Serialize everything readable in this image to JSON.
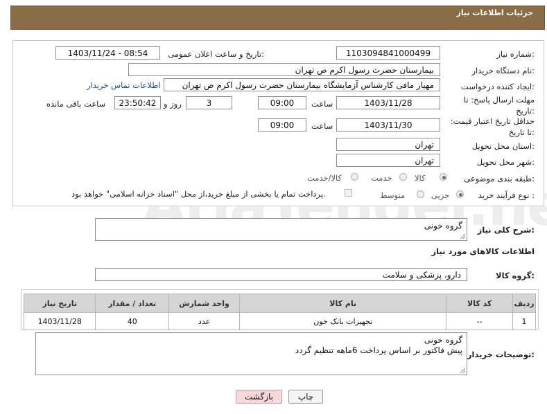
{
  "header": {
    "title": "جزئیات اطلاعات نیاز"
  },
  "form": {
    "need_number_label": "شماره نیاز:",
    "need_number": "1103094841000499",
    "announce_label": "تاریخ و ساعت اعلان عمومی:",
    "announce_value": "1403/11/24 - 08:54",
    "buyer_org_label": "نام دستگاه خریدار:",
    "buyer_org": "بیمارستان حضرت رسول اکرم ص  تهران",
    "creator_label": "ایجاد کننده درخواست:",
    "creator": "مهیار مافی کارشناس آزمایشگاه بیمارستان حضرت رسول اکرم ص  تهران",
    "contact_link": "اطلاعات تماس خریدار",
    "deadline_label": "مهلت ارسال پاسخ: تا تاریخ:",
    "deadline_date": "1403/11/28",
    "time_label": "ساعت",
    "deadline_time": "09:00",
    "days_count": "3",
    "days_label": "روز و",
    "remaining_time": "23:50:42",
    "remaining_label": "ساعت باقی مانده",
    "validity_label": "حداقل تاریخ اعتبار قیمت: تا تاریخ:",
    "validity_date": "1403/11/30",
    "validity_time": "09:00",
    "province_label": "استان محل تحویل:",
    "province": "تهران",
    "city_label": "شهر محل تحویل:",
    "city": "تهران",
    "category_label": "طبقه بندی موضوعی:",
    "category_options": [
      "کالا",
      "خدمت",
      "کالا/خدمت"
    ],
    "process_label": "نوع فرآیند خرید :",
    "process_options": [
      "جزیی",
      "متوسط"
    ],
    "payment_note": "پرداخت تمام یا بخشی از مبلغ خرید،از محل \"اسناد خزانه اسلامی\" خواهد بود."
  },
  "summary": {
    "label": "شرح کلی نیاز:",
    "value": "گروه خونی"
  },
  "goods": {
    "section_title": "اطلاعات کالاهای مورد نیاز",
    "group_label": "گروه کالا:",
    "group_value": "دارو، پزشکی و سلامت",
    "columns": [
      "ردیف",
      "کد کالا",
      "نام کالا",
      "واحد شمارش",
      "تعداد / مقدار",
      "تاریخ نیاز"
    ],
    "rows": [
      [
        "1",
        "--",
        "تجهیزات بانک خون",
        "عدد",
        "40",
        "1403/11/28"
      ]
    ]
  },
  "notes": {
    "label": "توضیحات خریدار:",
    "line1": "گروه خونی",
    "line2": "پیش فاکتور بر اساس پرداخت 6ماهه تنظیم گردد"
  },
  "buttons": {
    "print": "چاپ",
    "back": "بازگشت"
  },
  "watermark": "AriaTender.neT"
}
